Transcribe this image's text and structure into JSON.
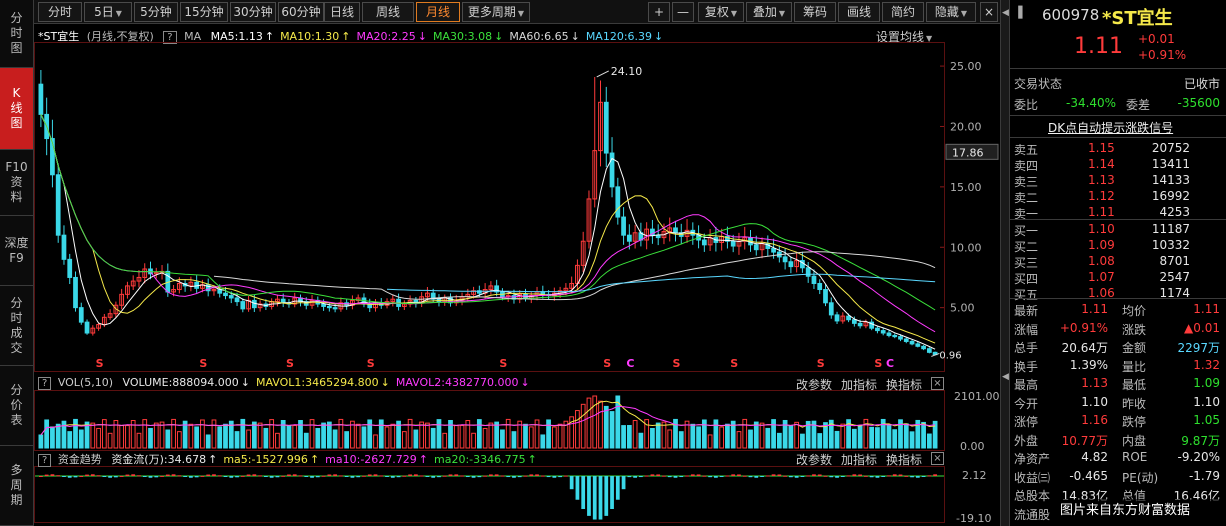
{
  "sidebar": {
    "items": [
      {
        "label": "分\n时\n图",
        "active": false
      },
      {
        "label": "K\n线\n图",
        "active": true
      },
      {
        "label": "F10\n资\n料",
        "active": false
      },
      {
        "label": "深度\nF9",
        "active": false
      },
      {
        "label": "分\n时\n成\n交",
        "active": false
      },
      {
        "label": "分\n价\n表",
        "active": false
      },
      {
        "label": "多\n周\n期",
        "active": false
      }
    ]
  },
  "toolbar": {
    "periods": [
      "分时",
      "5日",
      "5分钟",
      "15分钟",
      "30分钟",
      "60分钟",
      "日线",
      "周线",
      "月线",
      "更多周期"
    ],
    "active_period": "月线",
    "right_buttons": [
      "复权",
      "叠加",
      "筹码",
      "画线",
      "简约",
      "隐藏"
    ],
    "zoom_in": "+",
    "zoom_out": "—"
  },
  "kline": {
    "title": "*ST宜生",
    "subtitle": "(月线,不复权)",
    "help": "?",
    "ma_label": "MA",
    "ma": [
      {
        "text": "MA5:1.13",
        "arrow": "↑",
        "color": "#ffffff"
      },
      {
        "text": "MA10:1.30",
        "arrow": "↑",
        "color": "#f5e94a"
      },
      {
        "text": "MA20:2.25",
        "arrow": "↓",
        "color": "#ff3bff"
      },
      {
        "text": "MA30:3.08",
        "arrow": "↓",
        "color": "#3be03b"
      },
      {
        "text": "MA60:6.65",
        "arrow": "↓",
        "color": "#d8d8d8"
      },
      {
        "text": "MA120:6.39",
        "arrow": "↓",
        "color": "#5ad8ff"
      }
    ],
    "settings": "设置均线",
    "y_ticks": [
      "25.00",
      "20.00",
      "15.00",
      "10.00",
      "5.00"
    ],
    "price_tag": "17.86",
    "high_label": "24.10",
    "low_label": "0.96",
    "s_marker": "S",
    "c_marker": "C"
  },
  "volume": {
    "help": "?",
    "title": "VOL(5,10)",
    "items": [
      {
        "text": "VOLUME:888094.000",
        "arrow": "↓",
        "color": "#e8e8e8"
      },
      {
        "text": "MAVOL1:3465294.800",
        "arrow": "↓",
        "color": "#f5e94a"
      },
      {
        "text": "MAVOL2:4382770.000",
        "arrow": "↓",
        "color": "#ff3bff"
      }
    ],
    "y_ticks": [
      "2101.00",
      "0.00"
    ],
    "modify": "改参数",
    "add": "加指标",
    "swap": "换指标",
    "close": "×"
  },
  "capital": {
    "help": "?",
    "title": "资金趋势",
    "items": [
      {
        "text": "资金流(万):34.678",
        "arrow": "↑",
        "color": "#e8e8e8"
      },
      {
        "text": "ma5:-1527.996",
        "arrow": "↑",
        "color": "#f5e94a"
      },
      {
        "text": "ma10:-2627.729",
        "arrow": "↑",
        "color": "#ff3bff"
      },
      {
        "text": "ma20:-3346.775",
        "arrow": "↑",
        "color": "#3be03b"
      }
    ],
    "y_ticks": [
      "2.12",
      "-19.10"
    ],
    "modify": "改参数",
    "add": "加指标",
    "swap": "换指标",
    "close": "×"
  },
  "quote": {
    "code": "600978",
    "name": "*ST宜生",
    "price": "1.11",
    "change": "+0.01",
    "change_pct": "+0.91%",
    "trade_status_label": "交易状态",
    "trade_status": "已收市",
    "weibi_label": "委比",
    "weibi": "-34.40%",
    "weicha_label": "委差",
    "weicha": "-35600",
    "dk_banner": "DK点自动提示涨跌信号",
    "asks": [
      {
        "label": "卖五",
        "price": "1.15",
        "vol": "20752"
      },
      {
        "label": "卖四",
        "price": "1.14",
        "vol": "13411"
      },
      {
        "label": "卖三",
        "price": "1.13",
        "vol": "14133"
      },
      {
        "label": "卖二",
        "price": "1.12",
        "vol": "16992"
      },
      {
        "label": "卖一",
        "price": "1.11",
        "vol": "4253"
      }
    ],
    "bids": [
      {
        "label": "买一",
        "price": "1.10",
        "vol": "11187"
      },
      {
        "label": "买二",
        "price": "1.09",
        "vol": "10332"
      },
      {
        "label": "买三",
        "price": "1.08",
        "vol": "8701"
      },
      {
        "label": "买四",
        "price": "1.07",
        "vol": "2547"
      },
      {
        "label": "买五",
        "price": "1.06",
        "vol": "1174"
      }
    ],
    "stats": [
      {
        "l1": "最新",
        "v1": "1.11",
        "c1": "red",
        "l2": "均价",
        "v2": "1.11",
        "c2": "red"
      },
      {
        "l1": "涨幅",
        "v1": "+0.91%",
        "c1": "red",
        "l2": "涨跌",
        "v2": "▲0.01",
        "c2": "red"
      },
      {
        "l1": "总手",
        "v1": "20.64万",
        "c1": "white",
        "l2": "金额",
        "v2": "2297万",
        "c2": "cyan"
      },
      {
        "l1": "换手",
        "v1": "1.39%",
        "c1": "white",
        "l2": "量比",
        "v2": "1.32",
        "c2": "red"
      },
      {
        "l1": "最高",
        "v1": "1.13",
        "c1": "red",
        "l2": "最低",
        "v2": "1.09",
        "c2": "green"
      },
      {
        "l1": "今开",
        "v1": "1.10",
        "c1": "white",
        "l2": "昨收",
        "v2": "1.10",
        "c2": "white"
      },
      {
        "l1": "涨停",
        "v1": "1.16",
        "c1": "red",
        "l2": "跌停",
        "v2": "1.05",
        "c2": "green"
      },
      {
        "l1": "外盘",
        "v1": "10.77万",
        "c1": "red",
        "l2": "内盘",
        "v2": "9.87万",
        "c2": "green"
      },
      {
        "l1": "净资产",
        "v1": "4.82",
        "c1": "white",
        "l2": "ROE",
        "v2": "-9.20%",
        "c2": "white"
      },
      {
        "l1": "收益㈢",
        "v1": "-0.465",
        "c1": "white",
        "l2": "PE(动)",
        "v2": "-1.79",
        "c2": "white"
      },
      {
        "l1": "总股本",
        "v1": "14.83亿",
        "c1": "white",
        "l2": "总值",
        "v2": "16.46亿",
        "c2": "white"
      },
      {
        "l1": "流通股",
        "v1": "",
        "c1": "white",
        "l2": "",
        "v2": "",
        "c2": "white"
      }
    ],
    "watermark": "图片来自东方财富数据"
  },
  "colors": {
    "up": "#ff3b3b",
    "down": "#3bd8e8",
    "grid": "#5a1010",
    "accent": "#e07b20"
  }
}
